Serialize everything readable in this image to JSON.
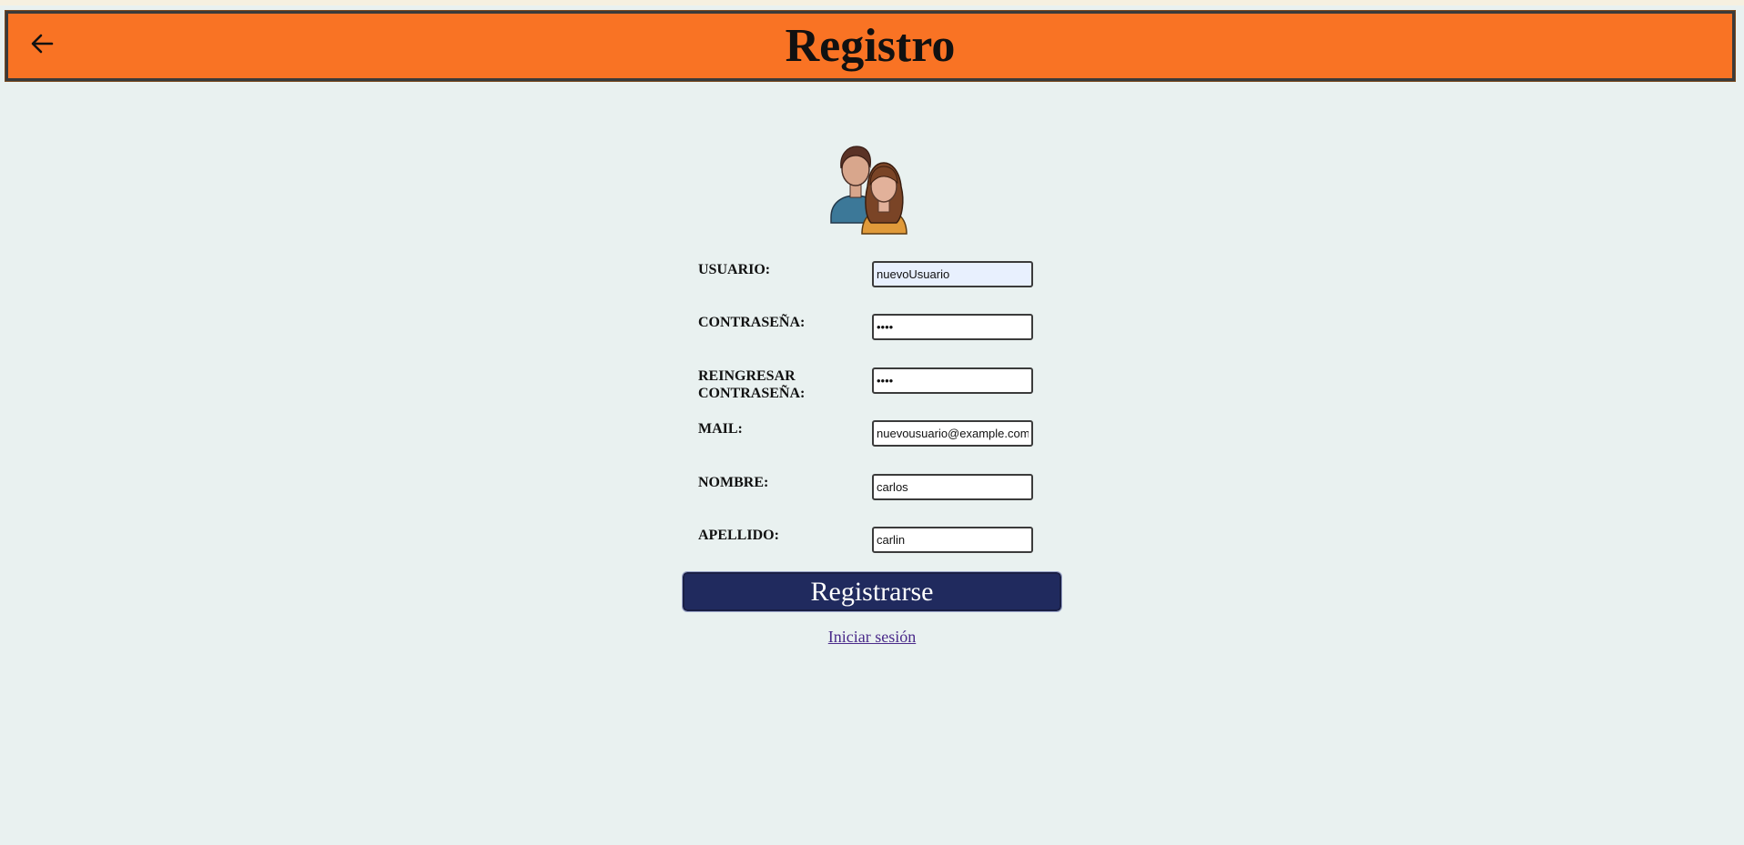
{
  "header": {
    "title": "Registro",
    "back_icon": "arrow-left-icon",
    "bg_color": "#f97324"
  },
  "avatar": {
    "icon": "users-icon"
  },
  "form": {
    "fields": [
      {
        "label": "USUARIO:",
        "value": "nuevoUsuario",
        "type": "text"
      },
      {
        "label": "CONTRASEÑA:",
        "value": "••••",
        "type": "password"
      },
      {
        "label": "REINGRESAR CONTRASEÑA:",
        "value": "••••",
        "type": "password"
      },
      {
        "label": "MAIL:",
        "value": "nuevousuario@example.com",
        "type": "email"
      },
      {
        "label": "NOMBRE:",
        "value": "carlos",
        "type": "text"
      },
      {
        "label": "APELLIDO:",
        "value": "carlin",
        "type": "text"
      }
    ],
    "submit_label": "Registrarse",
    "submit_color": "#202a5e"
  },
  "links": {
    "login_label": "Iniciar sesión"
  }
}
